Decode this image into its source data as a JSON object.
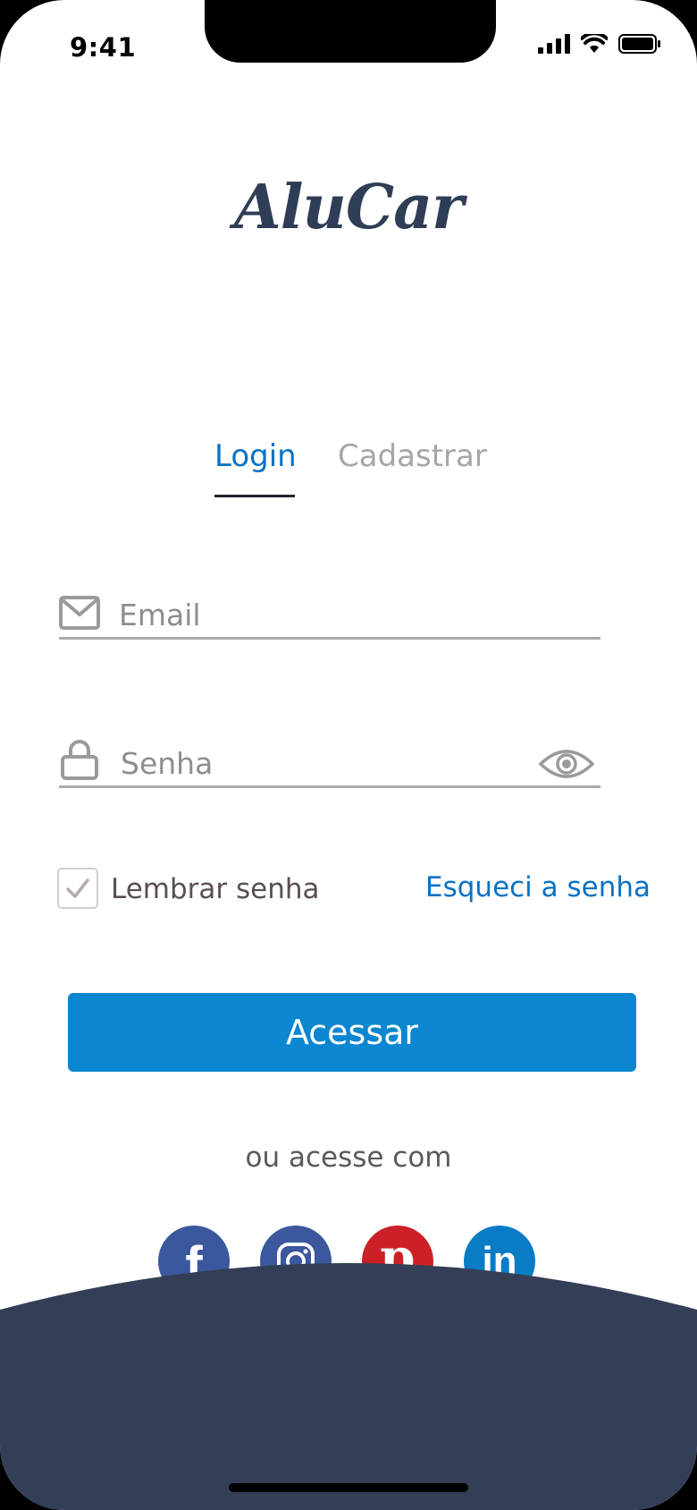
{
  "status_bar": {
    "time": "9:41"
  },
  "app": {
    "logo": "AluCar"
  },
  "tabs": [
    {
      "label": "Login",
      "active": true
    },
    {
      "label": "Cadastrar",
      "active": false
    }
  ],
  "form": {
    "email": {
      "placeholder": "Email",
      "value": ""
    },
    "password": {
      "placeholder": "Senha",
      "value": ""
    },
    "remember_label": "Lembrar senha",
    "remember_checked": true,
    "forgot_label": "Esqueci a senha",
    "submit_label": "Acessar"
  },
  "social": {
    "label": "ou acesse com",
    "providers": [
      {
        "name": "facebook",
        "glyph": "f",
        "color": "#3b579d"
      },
      {
        "name": "instagram",
        "color": "#3b579d"
      },
      {
        "name": "pinterest",
        "glyph": "p",
        "color": "#cb2027"
      },
      {
        "name": "linkedin",
        "glyph": "in",
        "color": "#0a7cc6"
      }
    ]
  },
  "colors": {
    "accent": "#0b86d0",
    "footer": "#333f56"
  }
}
